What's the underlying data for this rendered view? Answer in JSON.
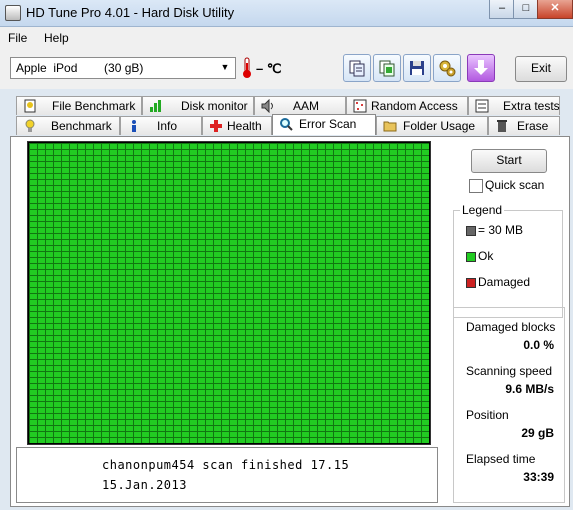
{
  "window": {
    "title": "HD Tune Pro 4.01 - Hard Disk Utility",
    "minimize": "–",
    "maximize": "□",
    "close": "✕"
  },
  "menu": {
    "file": "File",
    "help": "Help"
  },
  "toolbar": {
    "drive": "Apple  iPod        (30 gB)",
    "temperature": "– ℃",
    "exit_label": "Exit"
  },
  "tabs_top": [
    {
      "label": "File Benchmark",
      "icon": "file-benchmark-icon"
    },
    {
      "label": "Disk monitor",
      "icon": "disk-monitor-icon"
    },
    {
      "label": "AAM",
      "icon": "speaker-icon"
    },
    {
      "label": "Random Access",
      "icon": "random-access-icon"
    },
    {
      "label": "Extra tests",
      "icon": "extra-tests-icon"
    }
  ],
  "tabs_bottom": [
    {
      "label": "Benchmark",
      "icon": "lightbulb-icon"
    },
    {
      "label": "Info",
      "icon": "info-icon"
    },
    {
      "label": "Health",
      "icon": "health-cross-icon"
    },
    {
      "label": "Error Scan",
      "icon": "magnifier-icon",
      "active": true
    },
    {
      "label": "Folder Usage",
      "icon": "folder-icon"
    },
    {
      "label": "Erase",
      "icon": "trash-icon"
    }
  ],
  "scan": {
    "start_label": "Start",
    "quick_scan_label": "Quick scan",
    "quick_scan_checked": false,
    "grid_color_ok": "#22cc22",
    "damaged_blocks_count": 0
  },
  "legend": {
    "title": "Legend",
    "block_size": "= 30 MB",
    "ok": "Ok",
    "damaged": "Damaged",
    "colors": {
      "block": "#666666",
      "ok": "#22cc22",
      "damaged": "#cc2222"
    }
  },
  "stats": {
    "damaged_label": "Damaged blocks",
    "damaged_value": "0.0 %",
    "speed_label": "Scanning speed",
    "speed_value": "9.6 MB/s",
    "position_label": "Position",
    "position_value": "29 gB",
    "elapsed_label": "Elapsed time",
    "elapsed_value": "33:39"
  },
  "notes": {
    "line1": "chanonpum454 scan finished 17.15",
    "line2": "15.Jan.2013"
  }
}
